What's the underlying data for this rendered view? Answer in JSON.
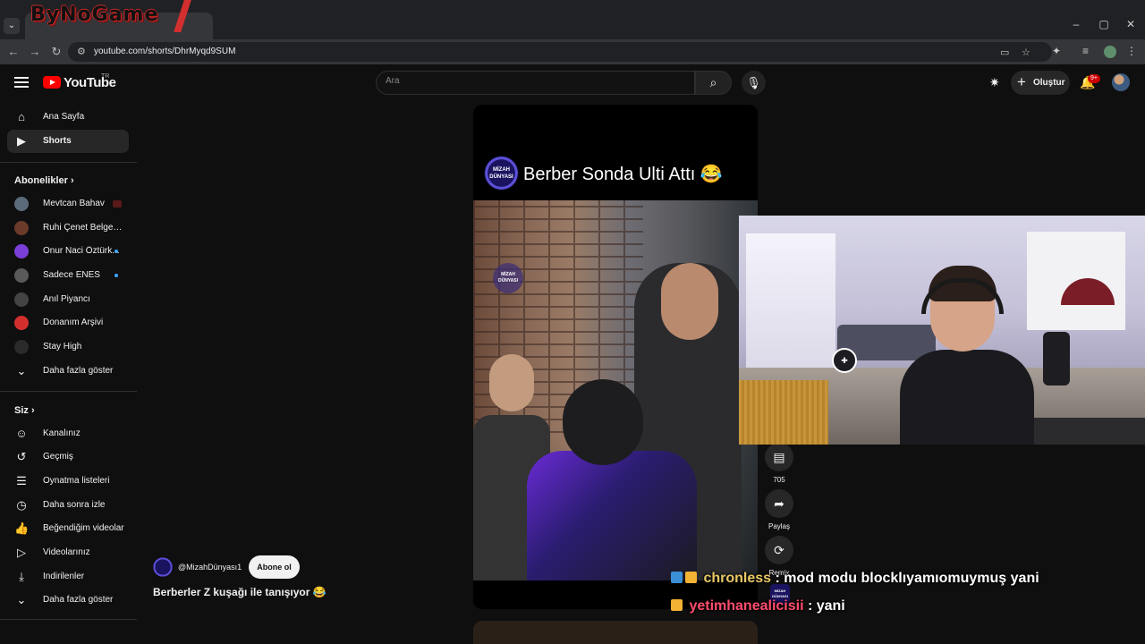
{
  "browser": {
    "watermark": "ByNoGame",
    "url": "youtube.com/shorts/DhrMyqd9SUM",
    "window_controls": {
      "minimize": "–",
      "maximize": "▢",
      "close": "✕"
    }
  },
  "header": {
    "logo_text": "YouTube",
    "region": "TR",
    "search_placeholder": "Ara",
    "create_label": "Oluştur",
    "notifications_badge": "9+"
  },
  "sidebar": {
    "main": [
      {
        "label": "Ana Sayfa",
        "icon": "home-icon",
        "active": false
      },
      {
        "label": "Shorts",
        "icon": "shorts-icon",
        "active": true
      }
    ],
    "subscriptions_heading": "Abonelikler",
    "subscriptions": [
      {
        "label": "Mevtcan Bahav",
        "avatar_color": "#5c6b7a",
        "status": "live"
      },
      {
        "label": "Ruhi Çenet Belgese...",
        "avatar_color": "#6b3a2a",
        "status": ""
      },
      {
        "label": "Onur Naci Öztürk...",
        "avatar_color": "#7a3fd6",
        "status": "new"
      },
      {
        "label": "Sadece ENES",
        "avatar_color": "#5a5a5a",
        "status": "new"
      },
      {
        "label": "Anıl Piyancı",
        "avatar_color": "#444444",
        "status": ""
      },
      {
        "label": "Donanım Arşivi",
        "avatar_color": "#d32f2f",
        "status": ""
      },
      {
        "label": "Stay High",
        "avatar_color": "#2a2a2a",
        "status": ""
      },
      {
        "label": "Daha fazla göster",
        "avatar_color": "",
        "status": ""
      }
    ],
    "you_heading": "Siz",
    "you": [
      {
        "label": "Kanalınız",
        "icon": "channel-icon"
      },
      {
        "label": "Geçmiş",
        "icon": "history-icon"
      },
      {
        "label": "Oynatma listeleri",
        "icon": "playlists-icon"
      },
      {
        "label": "Daha sonra izle",
        "icon": "watch-later-icon"
      },
      {
        "label": "Beğendiğim videolar",
        "icon": "liked-icon"
      },
      {
        "label": "Videolarınız",
        "icon": "your-videos-icon"
      },
      {
        "label": "İndirilenler",
        "icon": "downloads-icon"
      },
      {
        "label": "Daha fazla göster",
        "icon": "chevron-down-icon"
      }
    ]
  },
  "short": {
    "overlay_title": "Berber Sonda Ulti Attı 😂",
    "channel_logo_text": "MİZAH DÜNYASI",
    "channel_handle": "@MizahDünyası1",
    "subscribe_label": "Abone ol",
    "description": "Berberler Z kuşağı ile tanışıyor 😂",
    "actions": {
      "comments_count": "705",
      "share_label": "Paylaş",
      "remix_label": "Remix"
    }
  },
  "chat": [
    {
      "user": "chronless",
      "message": " : mod modu blocklıyamıomuymuş yani"
    },
    {
      "user": "yetimhanealicisii",
      "message": " : yani"
    }
  ],
  "colors": {
    "background": "#0f0f0f",
    "youtube_red": "#ff0000",
    "chat_user_1": "#e8c865",
    "chat_user_2": "#ff4d6d"
  }
}
